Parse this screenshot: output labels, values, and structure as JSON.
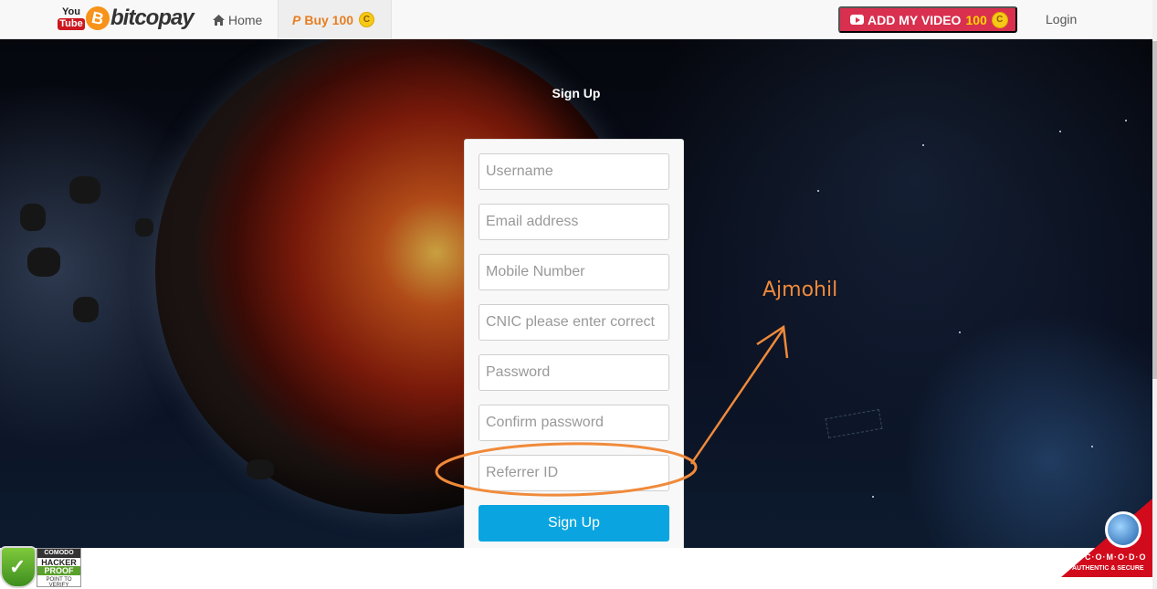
{
  "header": {
    "brand_you": "You",
    "brand_tube": "Tube",
    "brand_coin": "B",
    "brand_text": "bitcopay",
    "nav": {
      "home_label": "Home",
      "buy_label": "Buy 100",
      "buy_prefix": "P"
    },
    "coin_glyph": "C",
    "add_video_label": "ADD MY VIDEO",
    "add_video_amount": "100",
    "login_label": "Login"
  },
  "signup": {
    "title": "Sign Up",
    "fields": {
      "username_placeholder": "Username",
      "email_placeholder": "Email address",
      "mobile_placeholder": "Mobile Number",
      "cnic_placeholder": "CNIC please enter correct",
      "password_placeholder": "Password",
      "confirm_placeholder": "Confirm password",
      "referrer_placeholder": "Referrer ID"
    },
    "submit_label": "Sign Up"
  },
  "annotation": {
    "text": "Ajmohil",
    "color": "#f08a3a"
  },
  "badges": {
    "hacker": {
      "line1": "COMODO",
      "line2": "HACKER",
      "line3": "PROOF",
      "line4": "POINT TO VERIFY",
      "check": "✓"
    },
    "comodo": {
      "name": "C·O·M·O·D·O",
      "tagline": "AUTHENTIC & SECURE"
    }
  },
  "colors": {
    "accent_orange": "#e67e22",
    "add_video_bg": "#d9304f",
    "signup_button": "#0aa5e0"
  }
}
